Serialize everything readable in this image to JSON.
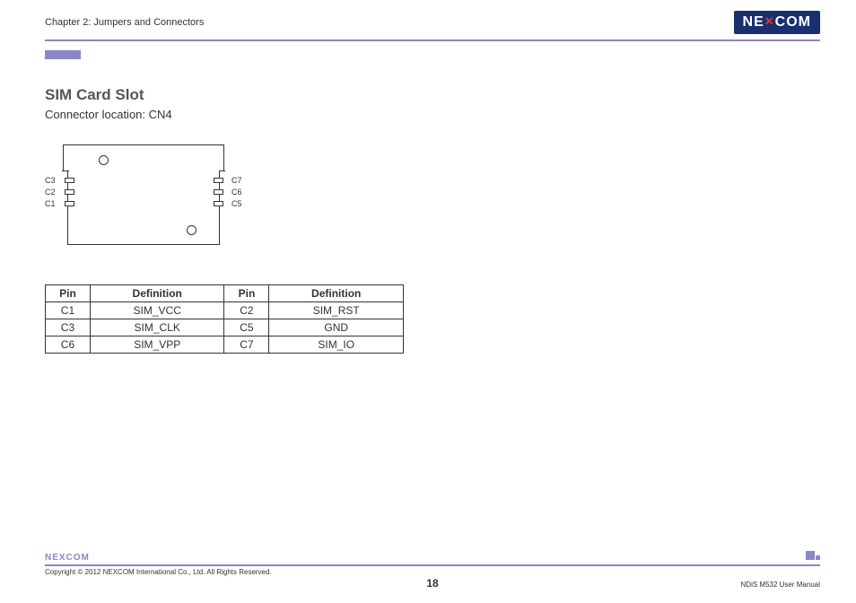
{
  "header": {
    "chapter": "Chapter 2: Jumpers and Connectors",
    "logo_text": "NE COM",
    "logo_x": "X"
  },
  "section": {
    "title": "SIM Card Slot",
    "connector_location": "Connector location: CN4"
  },
  "diagram": {
    "left_pins": [
      "C3",
      "C2",
      "C1"
    ],
    "right_pins": [
      "C7",
      "C6",
      "C5"
    ]
  },
  "table": {
    "headers": {
      "pin": "Pin",
      "definition": "Definition"
    },
    "rows": [
      {
        "p1": "C1",
        "d1": "SIM_VCC",
        "p2": "C2",
        "d2": "SIM_RST"
      },
      {
        "p1": "C3",
        "d1": "SIM_CLK",
        "p2": "C5",
        "d2": "GND"
      },
      {
        "p1": "C6",
        "d1": "SIM_VPP",
        "p2": "C7",
        "d2": "SIM_IO"
      }
    ]
  },
  "footer": {
    "logo": "NEXCOM",
    "copyright": "Copyright © 2012 NEXCOM International Co., Ltd. All Rights Reserved.",
    "page": "18",
    "manual": "NDiS M532 User Manual"
  }
}
